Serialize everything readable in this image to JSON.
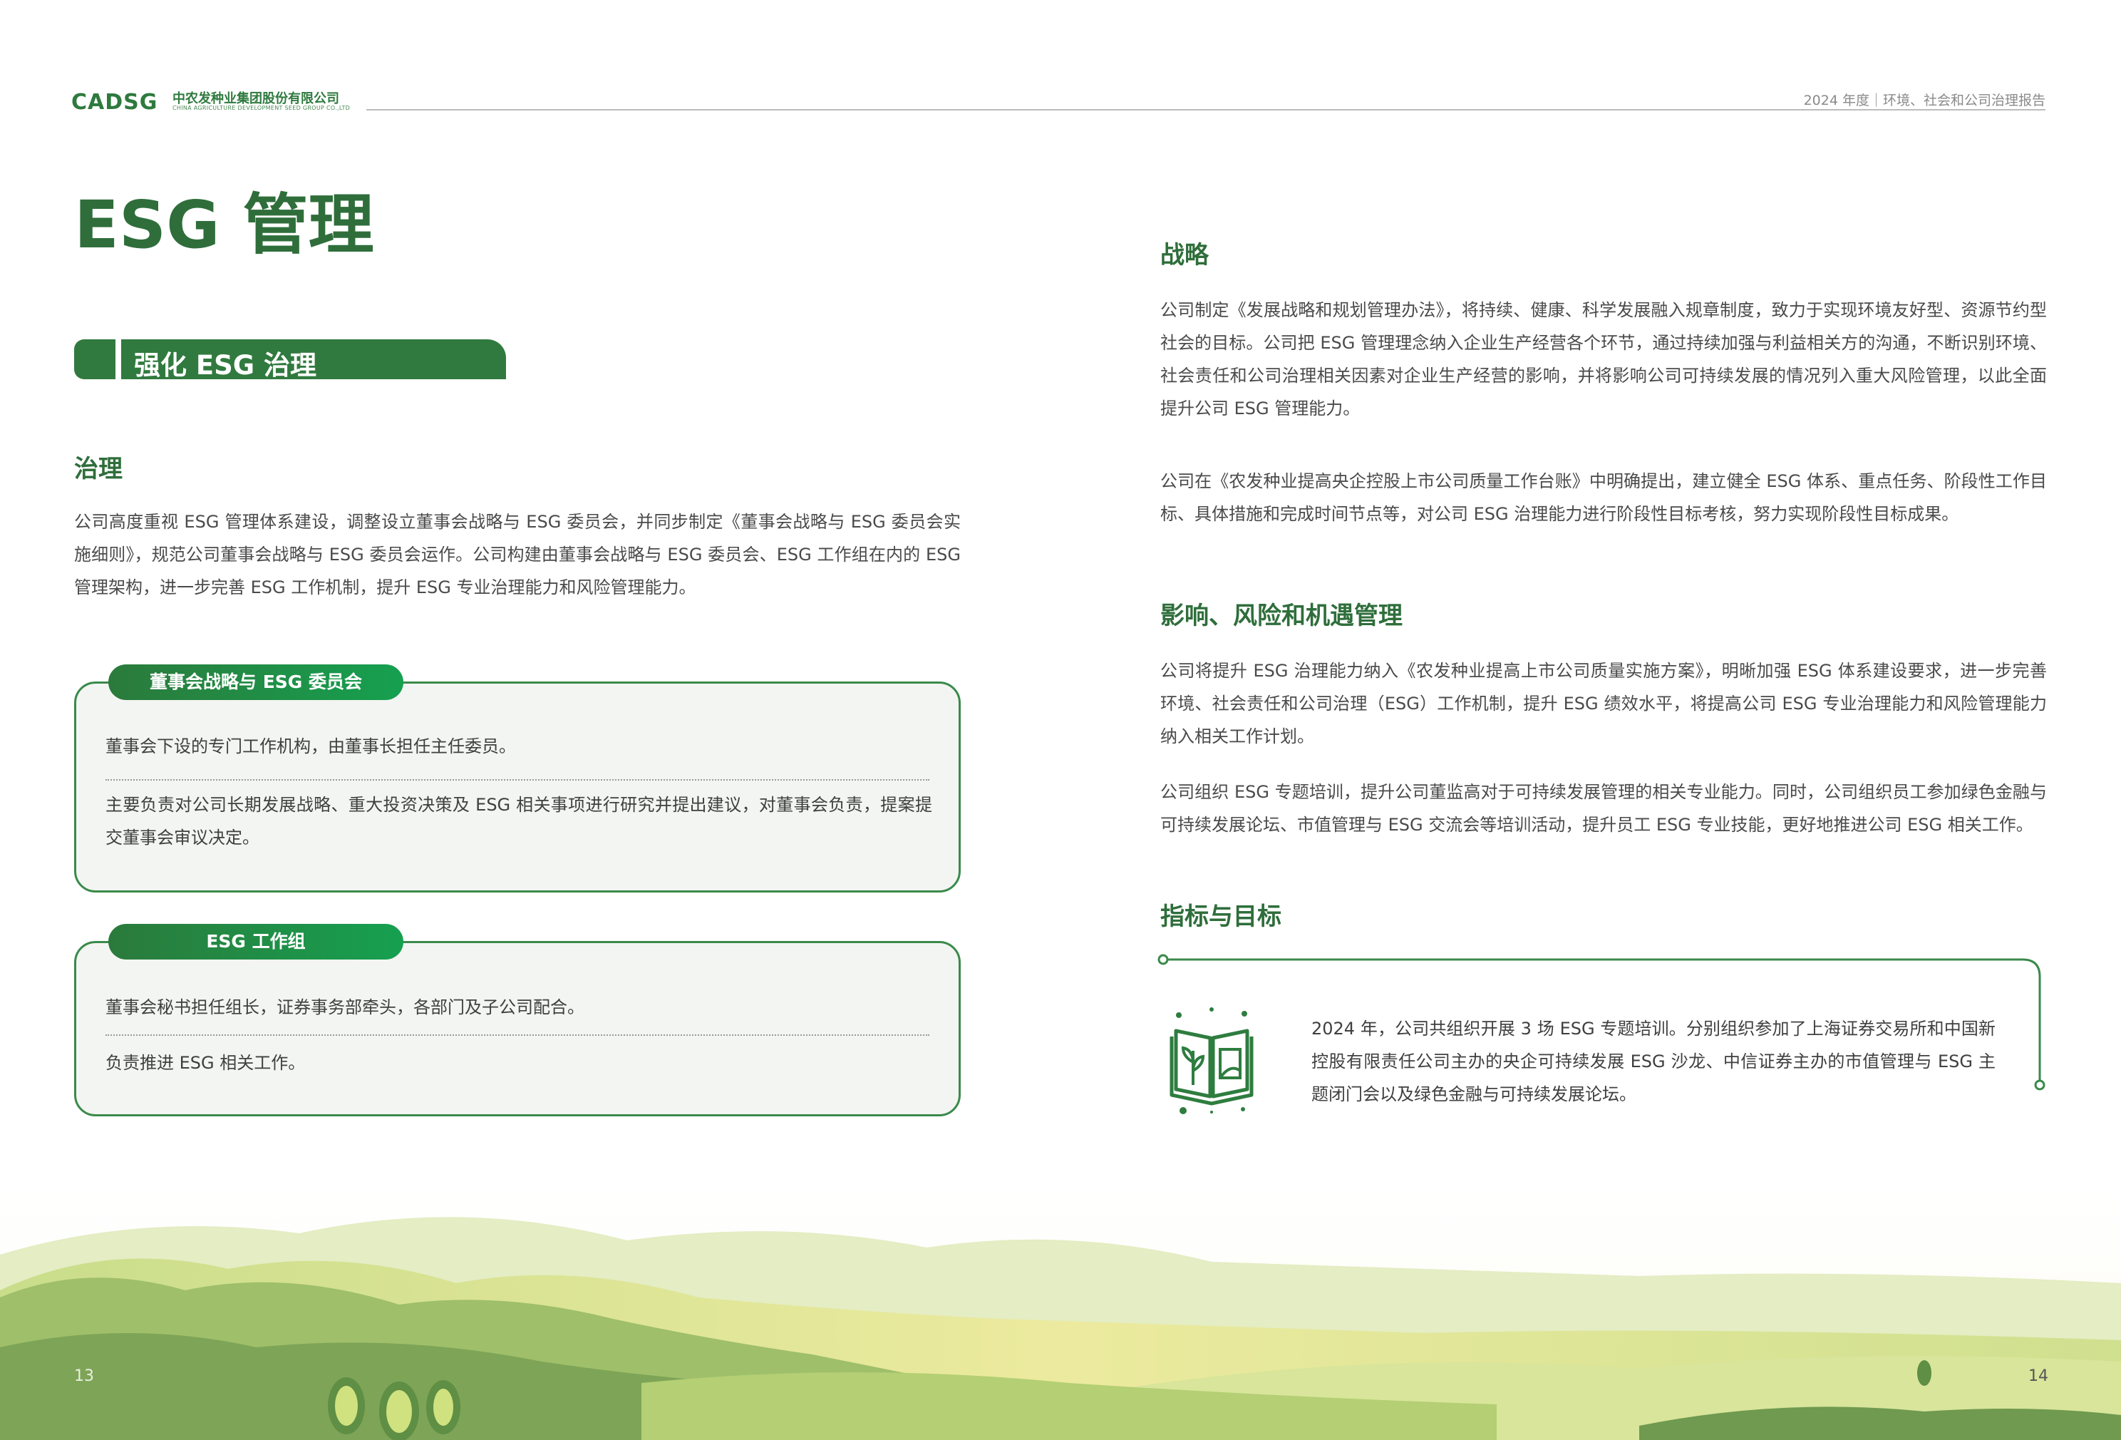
{
  "header": {
    "logo_mark": "CADSG",
    "company_cn": "中农发种业集团股份有限公司",
    "company_en": "CHINA AGRICULTURE DEVELOPMENT SEED GROUP CO.,LTD",
    "report_title": "2024 年度｜环境、社会和公司治理报告"
  },
  "left": {
    "page_title": "ESG 管理",
    "banner": "强化 ESG 治理",
    "governance": {
      "title": "治理",
      "body": "公司高度重视 ESG 管理体系建设，调整设立董事会战略与 ESG 委员会，并同步制定《董事会战略与 ESG 委员会实施细则》，规范公司董事会战略与 ESG 委员会运作。公司构建由董事会战略与 ESG 委员会、ESG 工作组在内的 ESG 管理架构，进一步完善 ESG 工作机制，提升 ESG 专业治理能力和风险管理能力。"
    },
    "committee": {
      "label": "董事会战略与 ESG 委员会",
      "line1": "董事会下设的专门工作机构，由董事长担任主任委员。",
      "line2": "主要负责对公司长期发展战略、重大投资决策及 ESG 相关事项进行研究并提出建议，对董事会负责，提案提交董事会审议决定。"
    },
    "working_group": {
      "label": "ESG 工作组",
      "line1": "董事会秘书担任组长，证券事务部牵头，各部门及子公司配合。",
      "line2": "负责推进 ESG 相关工作。"
    }
  },
  "right": {
    "strategy": {
      "title": "战略",
      "p1": "公司制定《发展战略和规划管理办法》，将持续、健康、科学发展融入规章制度，致力于实现环境友好型、资源节约型社会的目标。公司把 ESG 管理理念纳入企业生产经营各个环节，通过持续加强与利益相关方的沟通，不断识别环境、社会责任和公司治理相关因素对企业生产经营的影响，并将影响公司可持续发展的情况列入重大风险管理，以此全面提升公司 ESG 管理能力。",
      "p2": "公司在《农发种业提高央企控股上市公司质量工作台账》中明确提出，建立健全 ESG 体系、重点任务、阶段性工作目标、具体措施和完成时间节点等，对公司 ESG 治理能力进行阶段性目标考核，努力实现阶段性目标成果。"
    },
    "impact": {
      "title": "影响、风险和机遇管理",
      "p1": "公司将提升 ESG 治理能力纳入《农发种业提高上市公司质量实施方案》，明晰加强 ESG 体系建设要求，进一步完善环境、社会责任和公司治理（ESG）工作机制，提升 ESG 绩效水平，将提高公司 ESG 专业治理能力和风险管理能力纳入相关工作计划。",
      "p2": "公司组织 ESG 专题培训，提升公司董监高对于可持续发展管理的相关专业能力。同时，公司组织员工参加绿色金融与可持续发展论坛、市值管理与 ESG 交流会等培训活动，提升员工 ESG 专业技能，更好地推进公司 ESG 相关工作。"
    },
    "metrics": {
      "title": "指标与目标",
      "body": "2024 年，公司共组织开展 3 场 ESG 专题培训。分别组织参加了上海证券交易所和中国新控股有限责任公司主办的央企可持续发展 ESG 沙龙、中信证券主办的市值管理与 ESG 主题闭门会以及绿色金融与可持续发展论坛。"
    }
  },
  "pages": {
    "left": "13",
    "right": "14"
  },
  "colors": {
    "brand_green": "#2f6e3b",
    "accent_green": "#16a050",
    "panel_bg": "#f3f5f2"
  }
}
